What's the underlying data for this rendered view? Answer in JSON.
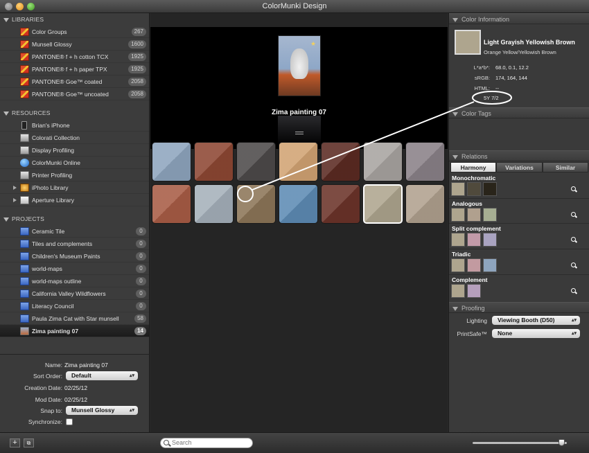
{
  "window": {
    "title": "ColorMunki Design"
  },
  "sidebar": {
    "libraries": {
      "header": "LIBRARIES",
      "items": [
        {
          "label": "Color Groups",
          "count": "267"
        },
        {
          "label": "Munsell Glossy",
          "count": "1600"
        },
        {
          "label": "PANTONE® f + h cotton TCX",
          "count": "1925"
        },
        {
          "label": "PANTONE® f + h paper TPX",
          "count": "1925"
        },
        {
          "label": "PANTONE® Goe™ coated",
          "count": "2058"
        },
        {
          "label": "PANTONE® Goe™ uncoated",
          "count": "2058"
        }
      ]
    },
    "resources": {
      "header": "RESOURCES",
      "items": [
        {
          "label": "Brian's iPhone",
          "icon": "iphone-icon"
        },
        {
          "label": "Colorati Collection",
          "icon": "colorati-icon"
        },
        {
          "label": "Display Profiling",
          "icon": "display-icon"
        },
        {
          "label": "ColorMunki Online",
          "icon": "globe-icon"
        },
        {
          "label": "Printer Profiling",
          "icon": "printer-icon"
        },
        {
          "label": "iPhoto Library",
          "icon": "iphoto-icon"
        },
        {
          "label": "Aperture Library",
          "icon": "aperture-icon"
        }
      ]
    },
    "projects": {
      "header": "PROJECTS",
      "items": [
        {
          "label": "Ceramic Tile",
          "count": "0"
        },
        {
          "label": "Tiles and complements",
          "count": "0"
        },
        {
          "label": "Children's Museum Paints",
          "count": "0"
        },
        {
          "label": "world-maps",
          "count": "0"
        },
        {
          "label": "world-maps outline",
          "count": "0"
        },
        {
          "label": "California Valley Wildflowers",
          "count": "0"
        },
        {
          "label": "Literacy Council",
          "count": "0"
        },
        {
          "label": "Paula Zima Cat with Star munsell",
          "count": "58"
        },
        {
          "label": "Zima painting 07",
          "count": "14"
        }
      ]
    }
  },
  "info": {
    "name_label": "Name:",
    "name_value": "Zima painting 07",
    "sort_label": "Sort Order:",
    "sort_value": "Default",
    "created_label": "Creation Date:",
    "created_value": "02/25/12",
    "mod_label": "Mod Date:",
    "mod_value": "02/25/12",
    "snap_label": "Snap to:",
    "snap_value": "Munsell Glossy",
    "sync_label": "Synchronize:"
  },
  "bottom": {
    "add": "+",
    "settings": "⧉",
    "search_placeholder": "Search",
    "zoom_level": 0.94
  },
  "preview": {
    "title": "Zima painting 07"
  },
  "swatches": [
    [
      "#8ea5be",
      "#8d4733",
      "#4d4a4a",
      "#d1a373",
      "#5b2a22",
      "#a8a4a1",
      "#8a8188"
    ],
    [
      "#a85c45",
      "#a5b0ba",
      "#8c7558",
      "#5d8bb4",
      "#6b3329",
      "#aea58e",
      "#b0a08e"
    ]
  ],
  "color_info": {
    "header": "Color Information",
    "name": "Light Grayish Yellowish Brown",
    "family": "Orange Yellow/Yellowish Brown",
    "lab_label": "L*a*b*:",
    "lab_value": "68.0, 0.1, 12.2",
    "srgb_label": "sRGB:",
    "srgb_value": "174, 164, 144",
    "html_label": "HTML:",
    "html_value": "--",
    "munsell_value": "5Y 7/2",
    "swatch_color": "#aea58e"
  },
  "color_tags": {
    "header": "Color Tags"
  },
  "relations": {
    "header": "Relations",
    "tabs": [
      "Harmony",
      "Variations",
      "Similar"
    ],
    "groups": [
      {
        "label": "Monochromatic",
        "colors": [
          "#aea58e",
          "#504a3c",
          "#29241a"
        ]
      },
      {
        "label": "Analogous",
        "colors": [
          "#aea58e",
          "#b0a08e",
          "#a6ae92"
        ]
      },
      {
        "label": "Split complement",
        "colors": [
          "#aea58e",
          "#c29aa8",
          "#a9a3c0"
        ]
      },
      {
        "label": "Triadic",
        "colors": [
          "#aea58e",
          "#c29aa0",
          "#8ea5be"
        ]
      },
      {
        "label": "Complement",
        "colors": [
          "#aea58e",
          "#b59fbc"
        ]
      }
    ]
  },
  "proofing": {
    "header": "Proofing",
    "lighting_label": "Lighting",
    "lighting_value": "Viewing Booth (D50)",
    "printsafe_label": "PrintSafe™",
    "printsafe_value": "None"
  }
}
